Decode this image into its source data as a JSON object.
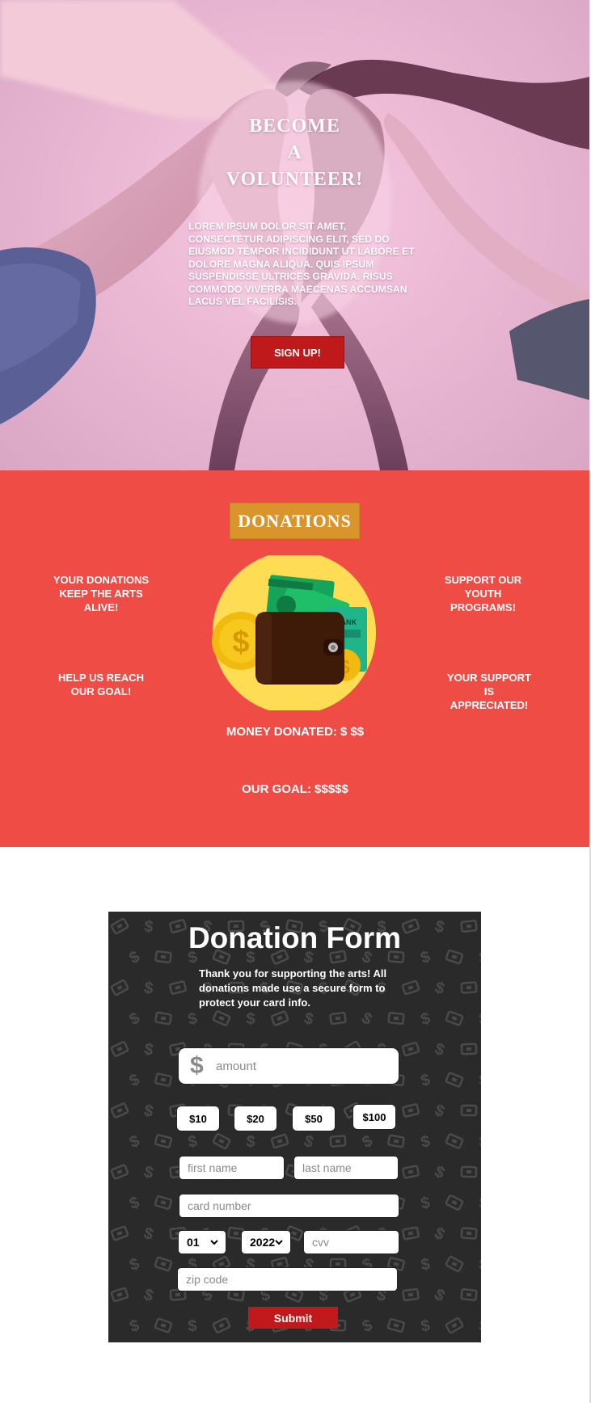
{
  "hero": {
    "title_lines": [
      "BECOME",
      "A",
      "VOLUNTEER!"
    ],
    "description": "LOREM IPSUM DOLOR SIT AMET, CONSECTETUR ADIPISCING ELIT, SED DO EIUSMOD TEMPOR INCIDIDUNT UT LABORE ET DOLORE MAGNA ALIQUA. QUIS IPSUM SUSPENDISSE ULTRICES GRAVIDA. RISUS COMMODO VIVERRA MAECENAS ACCUMSAN LACUS VEL FACILISIS.",
    "signup_label": "SIGN UP!"
  },
  "donations": {
    "title": "DONATIONS",
    "notes": [
      "YOUR DONATIONS KEEP THE ARTS ALIVE!",
      "SUPPORT OUR YOUTH PROGRAMS!",
      "HELP US REACH OUR GOAL!",
      "YOUR SUPPORT IS APPRECIATED!"
    ],
    "wallet_bank_label": "BANK",
    "money_donated": "MONEY DONATED: $ $$",
    "goal": "OUR GOAL: $$$$$"
  },
  "form": {
    "title": "Donation Form",
    "subtitle": "Thank you for supporting the arts! All donations made use a secure form to protect your card info.",
    "currency_symbol": "$",
    "amount_placeholder": "amount",
    "preset_amounts": [
      "$10",
      "$20",
      "$50",
      "$100"
    ],
    "first_name_placeholder": "first name",
    "last_name_placeholder": "last name",
    "card_number_placeholder": "card number",
    "month_selected": "01",
    "year_selected": "2022",
    "cvv_placeholder": "cvv",
    "zip_placeholder": "zip code",
    "submit_label": "Submit"
  },
  "colors": {
    "accent_red": "#c0191b",
    "donations_bg": "#ef4c45",
    "donations_title_bg": "#d9952c",
    "form_bg": "#2a2a2a"
  }
}
